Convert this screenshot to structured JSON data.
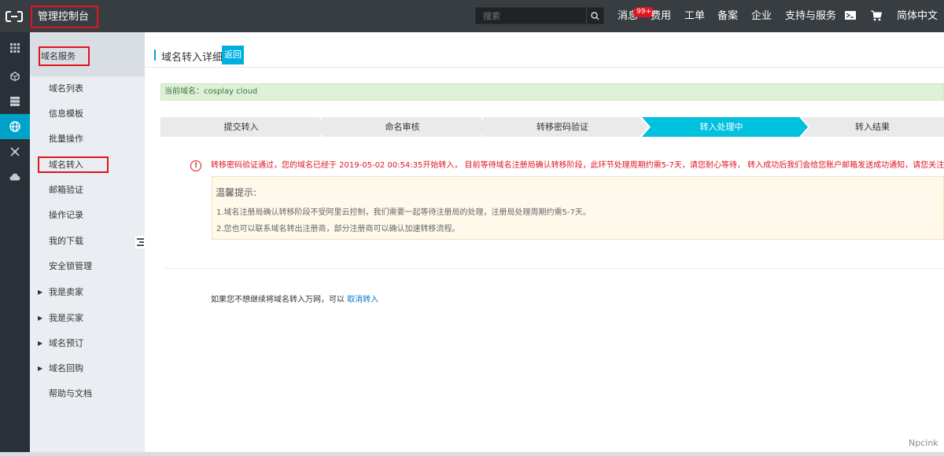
{
  "topbar": {
    "console_title": "管理控制台",
    "search_placeholder": "搜索",
    "nav": {
      "messages": "消息",
      "messages_badge": "99+",
      "billing": "费用",
      "tickets": "工单",
      "icp": "备案",
      "enterprise": "企业",
      "support": "支持与服务",
      "language": "简体中文"
    }
  },
  "sidebar": {
    "title": "域名服务",
    "items": [
      {
        "label": "域名列表"
      },
      {
        "label": "信息模板"
      },
      {
        "label": "批量操作"
      },
      {
        "label": "域名转入"
      },
      {
        "label": "邮箱验证"
      },
      {
        "label": "操作记录"
      },
      {
        "label": "我的下载"
      },
      {
        "label": "安全锁管理"
      },
      {
        "label": "我是卖家"
      },
      {
        "label": "我是买家"
      },
      {
        "label": "域名预订"
      },
      {
        "label": "域名回购"
      },
      {
        "label": "帮助与文档"
      }
    ]
  },
  "main": {
    "page_title": "域名转入详细",
    "back_label": "返回",
    "current_domain": "当前域名：cosplay cloud",
    "steps": [
      {
        "label": "提交转入",
        "active": false
      },
      {
        "label": "命名审核",
        "active": false
      },
      {
        "label": "转移密码验证",
        "active": false
      },
      {
        "label": "转入处理中",
        "active": true
      },
      {
        "label": "转入结果",
        "active": false
      }
    ],
    "notice_icon": "!",
    "notice": "转移密码验证通过，您的域名已经于 2019-05-02 00:54:35开始转入， 目前等待域名注册局确认转移阶段，此环节处理周期约需5-7天，请您耐心等待， 转入成功后我们会给您账户邮箱发送成功通知，请您关注。",
    "tip": {
      "title": "温馨提示:",
      "line1": "1.域名注册局确认转移阶段不受阿里云控制，我们需要一起等待注册局的处理，注册局处理周期约需5-7天。",
      "line2": "2.您也可以联系域名转出注册商，部分注册商可以确认加速转移流程。"
    },
    "cancel_text": "如果您不想继续将域名转入万网，可以",
    "cancel_link": "取消转入"
  },
  "watermark": "Npcink",
  "colors": {
    "topbar": "#373d41",
    "rail": "#293038",
    "accent": "#00a2ca",
    "highlight_box": "#e0141e",
    "notice_text": "#e0141e",
    "link": "#0077c8"
  },
  "icons": {
    "logo": "aliyun-logo-icon",
    "search": "search-icon",
    "mail": "mail-icon",
    "cart": "cart-icon",
    "rail": [
      "grid-icon",
      "cube-icon",
      "server-icon",
      "globe-icon",
      "network-icon",
      "cloud-icon"
    ],
    "collapse": "collapse-handle-icon"
  }
}
